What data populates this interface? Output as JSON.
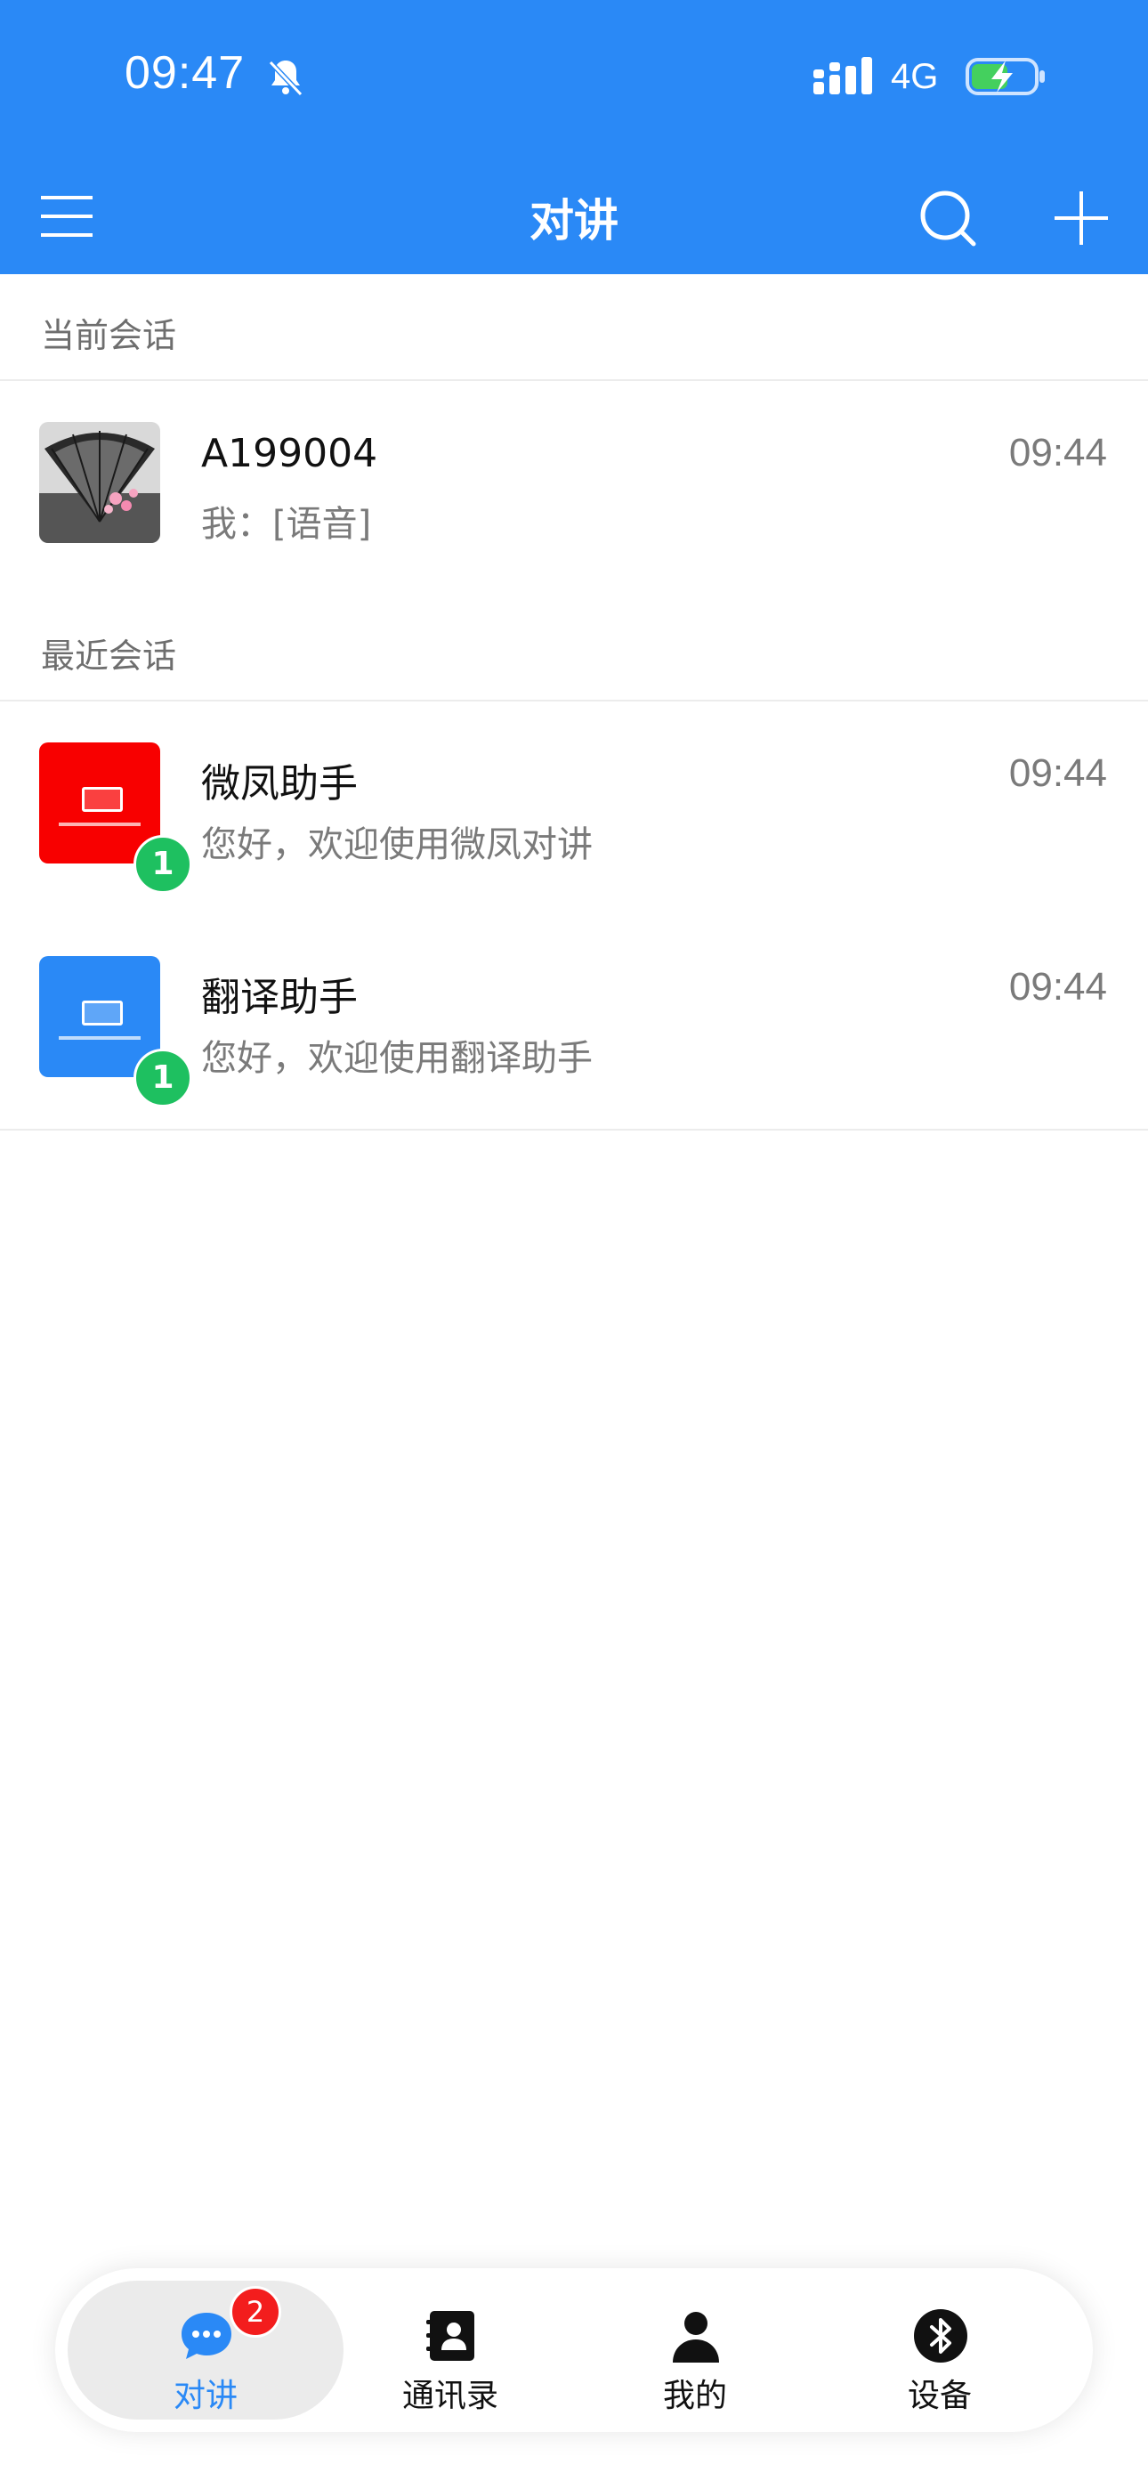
{
  "status_bar": {
    "time": "09:47",
    "network": "4G",
    "icons": [
      "bell-muted-icon",
      "signal-icon",
      "battery-charging-icon"
    ]
  },
  "nav": {
    "title": "对讲",
    "icons": [
      "menu-icon",
      "search-icon",
      "plus-icon"
    ]
  },
  "current_section": {
    "label": "当前会话",
    "items": [
      {
        "name": "A199004",
        "message": "我：[语音]",
        "time": "09:44"
      }
    ]
  },
  "recent_section": {
    "label": "最近会话",
    "items": [
      {
        "name": "微凤助手",
        "message": "您好，欢迎使用微凤对讲",
        "time": "09:44",
        "badge": "1",
        "avatar_color": "#f80000"
      },
      {
        "name": "翻译助手",
        "message": "您好，欢迎使用翻译助手",
        "time": "09:44",
        "badge": "1",
        "avatar_color": "#2a89f6"
      }
    ]
  },
  "tabbar": {
    "tabs": [
      {
        "label": "对讲",
        "icon": "chat-bubble-icon",
        "badge": "2",
        "active": true
      },
      {
        "label": "通讯录",
        "icon": "contacts-book-icon"
      },
      {
        "label": "我的",
        "icon": "person-icon"
      },
      {
        "label": "设备",
        "icon": "bluetooth-icon"
      }
    ]
  },
  "colors": {
    "primary": "#2a89f6",
    "badge_green": "#1ec060",
    "badge_red": "#f31d1d"
  }
}
